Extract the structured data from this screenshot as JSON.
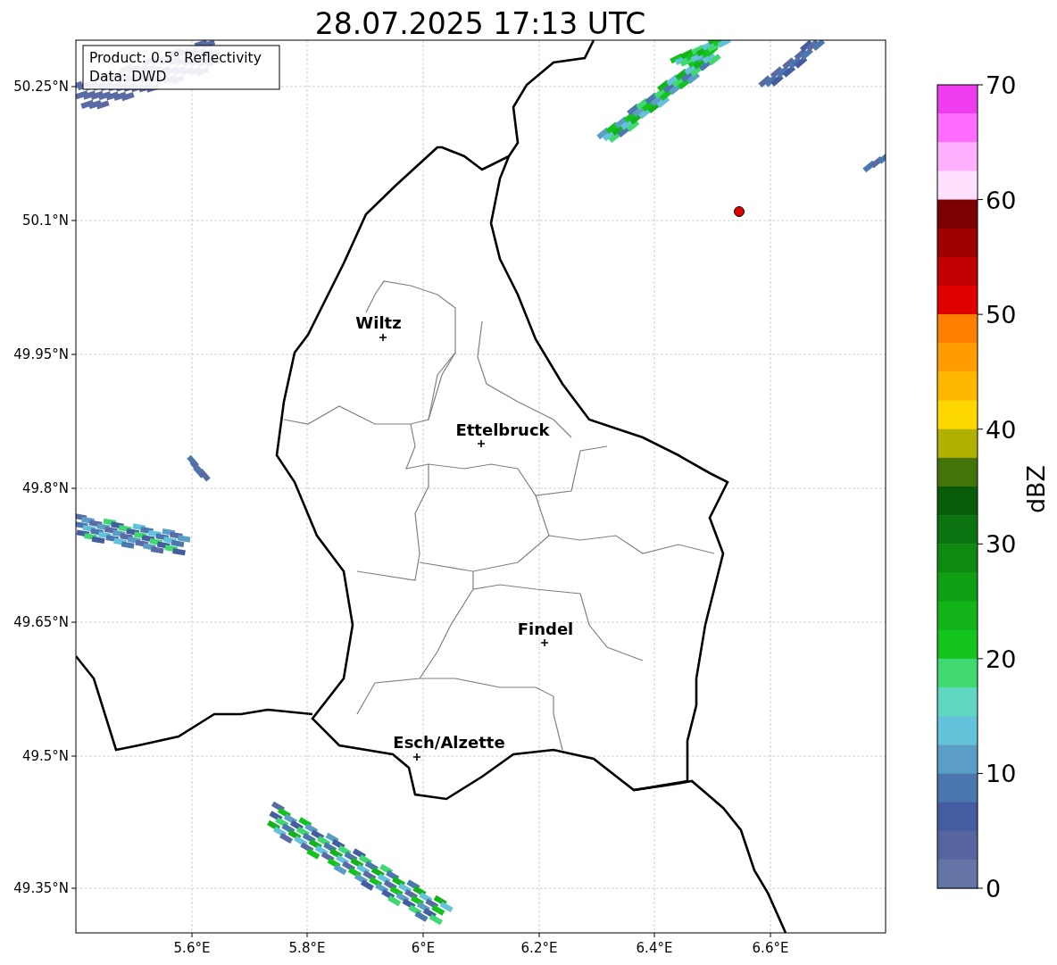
{
  "title": "28.07.2025 17:13 UTC",
  "map": {
    "info_box": {
      "lines": [
        "Product: 0.5° Reflectivity",
        "Data: DWD"
      ]
    },
    "cities": [
      {
        "name": "Wiltz"
      },
      {
        "name": "Ettelbruck"
      },
      {
        "name": "Findel"
      },
      {
        "name": "Esch/Alzette"
      }
    ],
    "lat_ticks": [
      "50.25°N",
      "50.1°N",
      "49.95°N",
      "49.8°N",
      "49.65°N",
      "49.5°N",
      "49.35°N"
    ],
    "lon_ticks": [
      "5.6°E",
      "5.8°E",
      "6°E",
      "6.2°E",
      "6.4°E",
      "6.6°E"
    ]
  },
  "colorbar": {
    "label": "dBZ",
    "ticks": [
      "70",
      "60",
      "50",
      "40",
      "30",
      "20",
      "10",
      "0"
    ],
    "bins": [
      {
        "color": "#ee3cee"
      },
      {
        "color": "#ff6cff"
      },
      {
        "color": "#ffb0ff"
      },
      {
        "color": "#ffe0ff"
      },
      {
        "color": "#7c0000"
      },
      {
        "color": "#9c0000"
      },
      {
        "color": "#c00000"
      },
      {
        "color": "#e00000"
      },
      {
        "color": "#ff8000"
      },
      {
        "color": "#ff9c00"
      },
      {
        "color": "#ffb800"
      },
      {
        "color": "#ffd700"
      },
      {
        "color": "#b0b000"
      },
      {
        "color": "#447408"
      },
      {
        "color": "#085c08"
      },
      {
        "color": "#0b7410"
      },
      {
        "color": "#0e8a10"
      },
      {
        "color": "#109e12"
      },
      {
        "color": "#12b41a"
      },
      {
        "color": "#14c41e"
      },
      {
        "color": "#40d870"
      },
      {
        "color": "#5ed6c0"
      },
      {
        "color": "#64c2da"
      },
      {
        "color": "#5a9ec6"
      },
      {
        "color": "#4a78ae"
      },
      {
        "color": "#445da0"
      },
      {
        "color": "#56659e"
      },
      {
        "color": "#6673a6"
      }
    ]
  }
}
